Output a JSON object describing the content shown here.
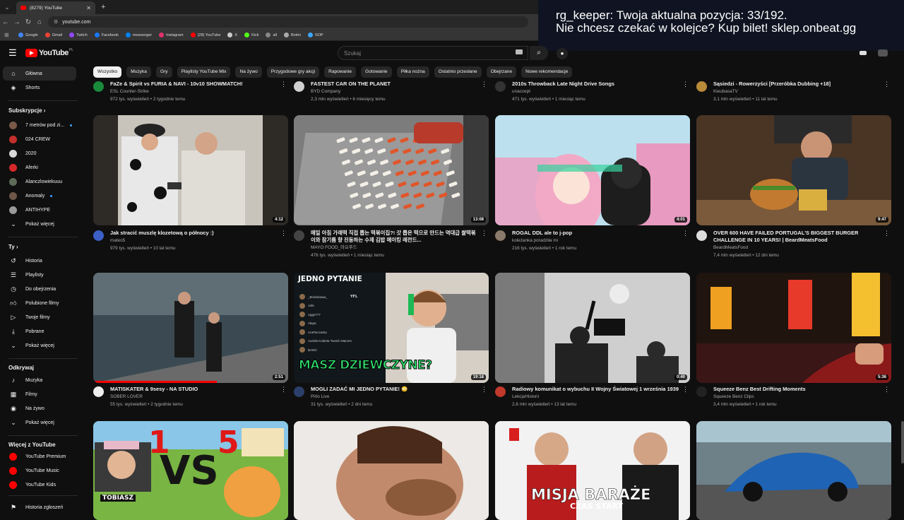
{
  "browser": {
    "tab_title": "(8279) YouTube",
    "url": "youtube.com",
    "bookmarks": [
      {
        "label": "Google",
        "color": "#4285f4"
      },
      {
        "label": "Gmail",
        "color": "#ea4335"
      },
      {
        "label": "Twitch",
        "color": "#9146ff"
      },
      {
        "label": "Facebook",
        "color": "#1877f2"
      },
      {
        "label": "messenger",
        "color": "#0084ff"
      },
      {
        "label": "Instagram",
        "color": "#e1306c"
      },
      {
        "label": "(28) YouTube",
        "color": "#ff0000"
      },
      {
        "label": "X",
        "color": "#cccccc"
      },
      {
        "label": "Kick",
        "color": "#53fc18"
      },
      {
        "label": "all",
        "color": "#888888"
      },
      {
        "label": "Botrix",
        "color": "#aaaaaa"
      },
      {
        "label": "SOP",
        "color": "#3ea6ff"
      }
    ]
  },
  "overlay": {
    "line1": "rg_keeper: Twoja aktualna pozycja: 33/192.",
    "line2": "Nie chcesz czekać w kolejce? Kup bilet! sklep.onbeat.gg"
  },
  "header": {
    "logo": "YouTube",
    "country": "PL",
    "search_placeholder": "Szukaj"
  },
  "chips": [
    "Wszystko",
    "Muzyka",
    "Gry",
    "Playlisty YouTube Mix",
    "Na żywo",
    "Przygodowe gry akcji",
    "Rapowanie",
    "Gotowanie",
    "Piłka nożna",
    "Ostatnio przesłane",
    "Obejrzane",
    "Nowe rekomendacje"
  ],
  "sidebar": {
    "main": [
      {
        "label": "Główna",
        "icon": "home-icon"
      },
      {
        "label": "Shorts",
        "icon": "shorts-icon"
      }
    ],
    "subs_header": "Subskrypcje",
    "subs": [
      {
        "label": "7 metrów pod zi...",
        "color": "#7a5a48"
      },
      {
        "label": "024 CREW",
        "color": "#c4302b"
      },
      {
        "label": "2020",
        "color": "#d8d8d8"
      },
      {
        "label": "Aferki",
        "color": "#d62828"
      },
      {
        "label": "Alanczlowiekuuu",
        "color": "#5d6b57"
      },
      {
        "label": "Anomaly",
        "color": "#6e5849"
      },
      {
        "label": "ANTIHYPE",
        "color": "#9a9a9a"
      }
    ],
    "show_more": "Pokaż więcej",
    "you_header": "Ty",
    "you": [
      {
        "label": "Historia",
        "icon": "history-icon"
      },
      {
        "label": "Playlisty",
        "icon": "playlist-icon"
      },
      {
        "label": "Do obejrzenia",
        "icon": "watch-later-icon"
      },
      {
        "label": "Polubione filmy",
        "icon": "like-icon"
      },
      {
        "label": "Twoje filmy",
        "icon": "your-videos-icon"
      },
      {
        "label": "Pobrane",
        "icon": "download-icon"
      }
    ],
    "explore_header": "Odkrywaj",
    "explore": [
      {
        "label": "Muzyka",
        "icon": "music-icon"
      },
      {
        "label": "Filmy",
        "icon": "film-icon"
      },
      {
        "label": "Na żywo",
        "icon": "live-icon"
      }
    ],
    "more_header": "Więcej z YouTube",
    "more": [
      {
        "label": "YouTube Premium"
      },
      {
        "label": "YouTube Music"
      },
      {
        "label": "YouTube Kids"
      }
    ],
    "last": "Historia zgłoszeń"
  },
  "videos_top": [
    {
      "title": "FaZe & Spirit vs FURIA & NAVI - 10v10 SHOWMATCH!",
      "channel": "ESL Counter-Strike",
      "stats": "972 tys. wyświetleń • 2 tygodnie temu",
      "color": "#1a8a3c"
    },
    {
      "title": "FASTEST CAR ON THE PLANET",
      "channel": "BYD Company",
      "stats": "2,3 mln wyświetleń • 6 miesięcy temu",
      "color": "#d0d0d0"
    },
    {
      "title": "2010s Throwback Late Night Drive Songs",
      "channel": "unaccept",
      "stats": "471 tys. wyświetleń • 1 miesiąc temu",
      "color": "#333333"
    },
    {
      "title": "Sąsiedzi - Rowerzyści [Przeróbka Dubbing +18]",
      "channel": "KieubasaTV",
      "stats": "3,1 mln wyświetleń • 11 lat temu",
      "color": "#b98a3a"
    }
  ],
  "videos_row1": [
    {
      "title": "Jak stracić muszlę klozetową o północy :)",
      "channel": "mateo5",
      "stats": "979 tys. wyświetleń • 10 lat temu",
      "duration": "4:12",
      "color": "#3b5fc4"
    },
    {
      "title": "매일 아침 가래떡 직접 뽑는 떡볶이집?! 갓 뽑은 떡으로 만드는 역대급 쌀떡볶이와 참기름 향 진동하는 수제 김밥 메이킹 레전드...",
      "channel": "MAYO FOOD_마요푸드",
      "stats": "476 tys. wyświetleń • 1 miesiąc temu",
      "duration": "13:08",
      "color": "#444444"
    },
    {
      "title": "ROGAL DDL ale to j-pop",
      "channel": "koleżanka poradziła mi",
      "stats": "216 tys. wyświetleń • 1 rok temu",
      "duration": "4:01",
      "color": "#8a7a6a"
    },
    {
      "title": "OVER 600 HAVE FAILED PORTUGAL'S BIGGEST BURGER CHALLENGE IN 10 YEARS! | BeardMeatsFood",
      "channel": "BeardMeatsFood",
      "stats": "7,4 mln wyświetleń • 12 dni temu",
      "duration": "9:47",
      "color": "#dddddd"
    }
  ],
  "videos_row2": [
    {
      "title": "MATISKATER & 9sesy - NA STUDIO",
      "channel": "SOBER LOVER",
      "stats": "55 tys. wyświetleń • 2 tygodnie temu",
      "duration": "2:51",
      "color": "#eeeeee"
    },
    {
      "title": "MOGLI ZADAĆ MI JEDNO PYTANIE! 😳",
      "channel": "Pirlo Live",
      "stats": "31 tys. wyświetleń • 2 dni temu",
      "duration": "19:18",
      "color": "#2b3f6a"
    },
    {
      "title": "Radiowy komunikat o wybuchu II Wojny Światowej 1 września 1939",
      "channel": "LekcjaHistorii",
      "stats": "2,6 mln wyświetleń • 13 lat temu",
      "duration": "0:40",
      "color": "#c0392b"
    },
    {
      "title": "Squeeze Benz Best Drifting Moments",
      "channel": "Squeeze Benz Clips",
      "stats": "3,4 mln wyświetleń • 1 rok temu",
      "duration": "5:36",
      "color": "#222222"
    }
  ],
  "thumb_text": {
    "jedno": "JEDNO PYTANIE",
    "masz": "MASZ DZIEWCZYNE?",
    "yfl": "YFL",
    "chat": [
      "_Brokulasaa_",
      "Adis",
      "Aggs777",
      "Alepa",
      "AroPieczarka",
      "Aurelia Kobieta Twoich Marzen",
      "BANG"
    ],
    "vs": "VS",
    "one": "1",
    "five": "5",
    "tobiasz": "TOBIASZ",
    "misja": "MISJA BARAŻE",
    "czas": "CZAS START"
  }
}
